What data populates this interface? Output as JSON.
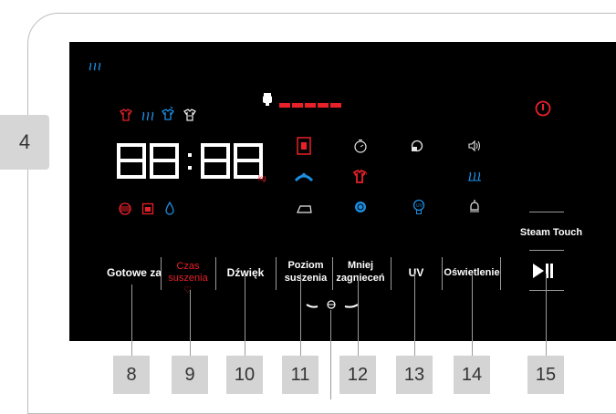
{
  "side_tab": {
    "label": "4"
  },
  "display": {
    "time_digits": "88:88",
    "kg_unit": "kg"
  },
  "buttons": [
    {
      "id": "gotowe-za",
      "label": "Gotowe za"
    },
    {
      "id": "czas-suszenia",
      "label": "Czas suszenia"
    },
    {
      "id": "dzwiek",
      "label": "Dźwięk"
    },
    {
      "id": "poziom-suszenia",
      "label": "Poziom suszenia"
    },
    {
      "id": "mniej-zagniecen",
      "label": "Mniej zagnieceń"
    },
    {
      "id": "uv",
      "label": "UV"
    },
    {
      "id": "oswietlenie",
      "label": "Oświetlenie"
    }
  ],
  "steam_touch": {
    "label": "Steam Touch"
  },
  "play_pause": {
    "symbol": "▶II"
  },
  "callouts": [
    "8",
    "9",
    "10",
    "11",
    "12",
    "13",
    "14",
    "15"
  ],
  "icons": {
    "steam_top": "ﾟ♨ﾟ",
    "power": "⏻",
    "heart": "♡"
  },
  "colors": {
    "panel": "#000000",
    "accent_red": "#e8202a",
    "accent_blue": "#1c8de0"
  }
}
